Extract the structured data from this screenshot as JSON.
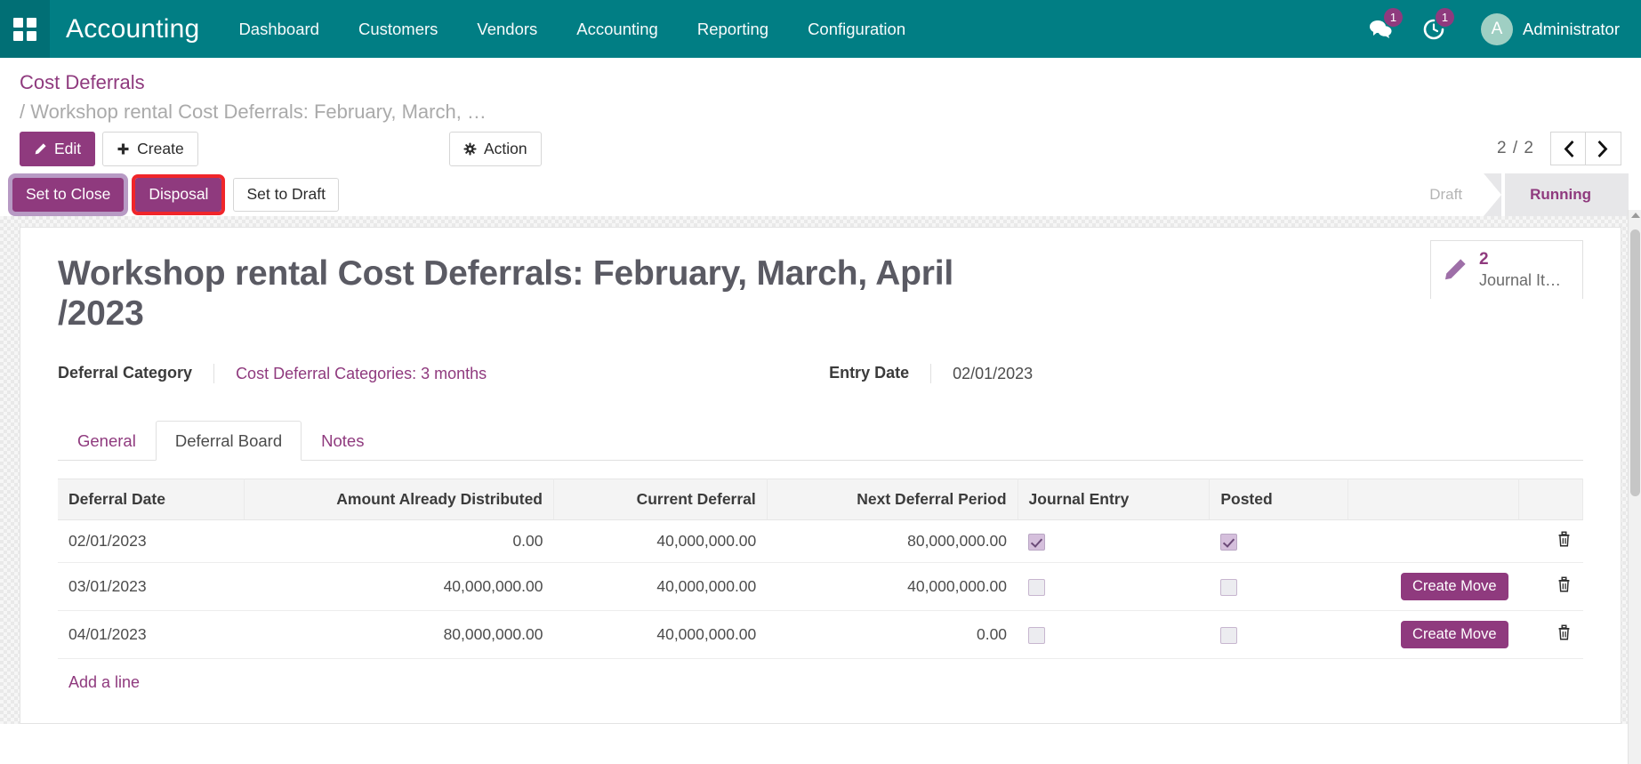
{
  "navbar": {
    "apps_icon": "apps-grid-icon",
    "brand": "Accounting",
    "menu": [
      {
        "label": "Dashboard"
      },
      {
        "label": "Customers"
      },
      {
        "label": "Vendors"
      },
      {
        "label": "Accounting"
      },
      {
        "label": "Reporting"
      },
      {
        "label": "Configuration"
      }
    ],
    "messaging": {
      "icon": "chat-bubbles-icon",
      "count": "1"
    },
    "activity": {
      "icon": "clock-activity-icon",
      "count": "1"
    },
    "user": {
      "initial": "A",
      "name": "Administrator"
    }
  },
  "breadcrumb": {
    "root": "Cost Deferrals",
    "separator": "/",
    "current": "Workshop rental Cost Deferrals: February, March, …"
  },
  "controls": {
    "edit_label": "Edit",
    "create_label": "Create",
    "action_label": "Action",
    "pager_count": "2 / 2",
    "prev_icon": "chevron-left-icon",
    "next_icon": "chevron-right-icon"
  },
  "statusbuttons": [
    {
      "label": "Set to Close",
      "style": "purple",
      "highlight": "lilac"
    },
    {
      "label": "Disposal",
      "style": "purple",
      "highlight": "red"
    },
    {
      "label": "Set to Draft",
      "style": "default",
      "highlight": "none"
    }
  ],
  "statusbar": {
    "stages": [
      {
        "label": "Draft",
        "active": false
      },
      {
        "label": "Running",
        "active": true
      }
    ]
  },
  "smart_button": {
    "icon": "pencil-icon",
    "value": "2",
    "label": "Journal It…"
  },
  "record": {
    "title": "Workshop rental Cost Deferrals: February, March, April /2023",
    "fields": [
      {
        "label": "Deferral Category",
        "value": "Cost Deferral Categories: 3 months",
        "is_link": true
      },
      {
        "label": "Entry Date",
        "value": "02/01/2023",
        "is_link": false
      }
    ]
  },
  "tabs": [
    {
      "label": "General",
      "active": false
    },
    {
      "label": "Deferral Board",
      "active": true
    },
    {
      "label": "Notes",
      "active": false
    }
  ],
  "table": {
    "columns": [
      "Deferral Date",
      "Amount Already Distributed",
      "Current Deferral",
      "Next Deferral Period",
      "Journal Entry",
      "Posted",
      "",
      ""
    ],
    "rows": [
      {
        "date": "02/01/2023",
        "already_distributed": "0.00",
        "current_deferral": "40,000,000.00",
        "next_period": "80,000,000.00",
        "journal_entry": true,
        "posted": true,
        "action_label": "",
        "delete_icon": "trash-icon"
      },
      {
        "date": "03/01/2023",
        "already_distributed": "40,000,000.00",
        "current_deferral": "40,000,000.00",
        "next_period": "40,000,000.00",
        "journal_entry": false,
        "posted": false,
        "action_label": "Create Move",
        "delete_icon": "trash-icon"
      },
      {
        "date": "04/01/2023",
        "already_distributed": "80,000,000.00",
        "current_deferral": "40,000,000.00",
        "next_period": "0.00",
        "journal_entry": false,
        "posted": false,
        "action_label": "Create Move",
        "delete_icon": "trash-icon"
      }
    ],
    "add_line_label": "Add a line"
  },
  "colors": {
    "navbar_teal": "#017e84",
    "accent_purple": "#8f3a7e",
    "highlight_red": "#f0252a",
    "highlight_lilac": "#b79ac4"
  }
}
